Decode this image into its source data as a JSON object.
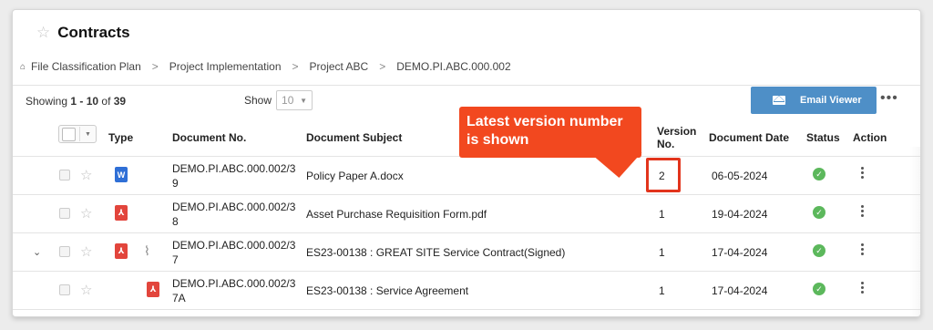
{
  "page": {
    "title": "Contracts"
  },
  "breadcrumb": [
    "File Classification Plan",
    "Project Implementation",
    "Project ABC",
    "DEMO.PI.ABC.000.002"
  ],
  "breadcrumb_sep": ">",
  "pagination": {
    "prefix": "Showing ",
    "range": "1 - 10",
    "of_text": " of ",
    "total": "39"
  },
  "page_size": {
    "label": "Show",
    "value": "10"
  },
  "toolbar": {
    "email_label": "Email Viewer"
  },
  "columns": {
    "type": "Type",
    "doc_no": "Document No.",
    "subject": "Document Subject",
    "version_line1": "Version",
    "version_line2": "No.",
    "date": "Document Date",
    "status": "Status",
    "action": "Action"
  },
  "rows": [
    {
      "doc_no_1": "DEMO.PI.ABC.000.002/3",
      "doc_no_2": "9",
      "subject": "Policy Paper A.docx",
      "version": "2",
      "date": "06-05-2024",
      "file_type": "word",
      "file_icon_label": "W",
      "status": "approved"
    },
    {
      "doc_no_1": "DEMO.PI.ABC.000.002/3",
      "doc_no_2": "8",
      "subject": "Asset Purchase Requisition Form.pdf",
      "version": "1",
      "date": "19-04-2024",
      "file_type": "pdf",
      "file_icon_label": "",
      "status": "approved"
    },
    {
      "doc_no_1": "DEMO.PI.ABC.000.002/3",
      "doc_no_2": "7",
      "subject": "ES23-00138 : GREAT SITE Service Contract(Signed)",
      "version": "1",
      "date": "17-04-2024",
      "file_type": "pdf",
      "file_icon_label": "",
      "status": "approved",
      "expandable": true,
      "has_attachment": true
    },
    {
      "doc_no_1": "DEMO.PI.ABC.000.002/3",
      "doc_no_2": "7A",
      "subject": "ES23-00138 : Service Agreement",
      "version": "1",
      "date": "17-04-2024",
      "file_type": "pdf",
      "file_icon_label": "",
      "status": "approved",
      "child": true
    }
  ],
  "callout": {
    "line1": "Latest version number",
    "line2": "is shown"
  },
  "colors": {
    "accent": "#4e8fc7",
    "callout": "#f2481f",
    "status_ok": "#5cb85c",
    "word": "#2f6fd6",
    "pdf": "#e2453c"
  },
  "icons": {
    "title_star": "star-outline-icon",
    "home": "home-icon",
    "email": "envelope-icon",
    "status": "check-circle-icon"
  }
}
